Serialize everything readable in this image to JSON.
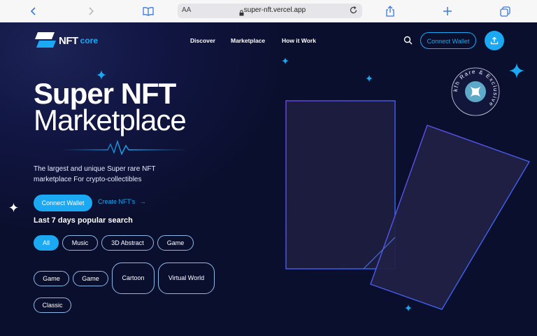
{
  "browser": {
    "url": "super-nft.vercel.app",
    "text_size_label": "AA"
  },
  "header": {
    "logo_text": "NFT",
    "logo_sub": "core",
    "nav": [
      "Discover",
      "Marketplace",
      "How it Work"
    ],
    "connect_wallet": "Connect Wallet"
  },
  "hero": {
    "title_line1": "Super NFT",
    "title_line2": "Marketplace",
    "description": "The largest and unique Super rare NFT marketplace For crypto-collectibles",
    "primary_button": "Connect Wallet",
    "secondary_link": "Create NFT's",
    "secondary_arrow": "→"
  },
  "popular": {
    "heading": "Last 7 days popular search",
    "tags": [
      "All",
      "Music",
      "3D Abstract",
      "Game",
      "Game",
      "Game",
      "Cartoon",
      "Virtual World",
      "Classic"
    ],
    "active_tag": "All"
  },
  "badge": {
    "ring_text": "kfh Rare & Exclusive"
  },
  "colors": {
    "accent": "#1ba9f3",
    "background": "#0b0f2e",
    "card_border": "#6b48e8"
  }
}
